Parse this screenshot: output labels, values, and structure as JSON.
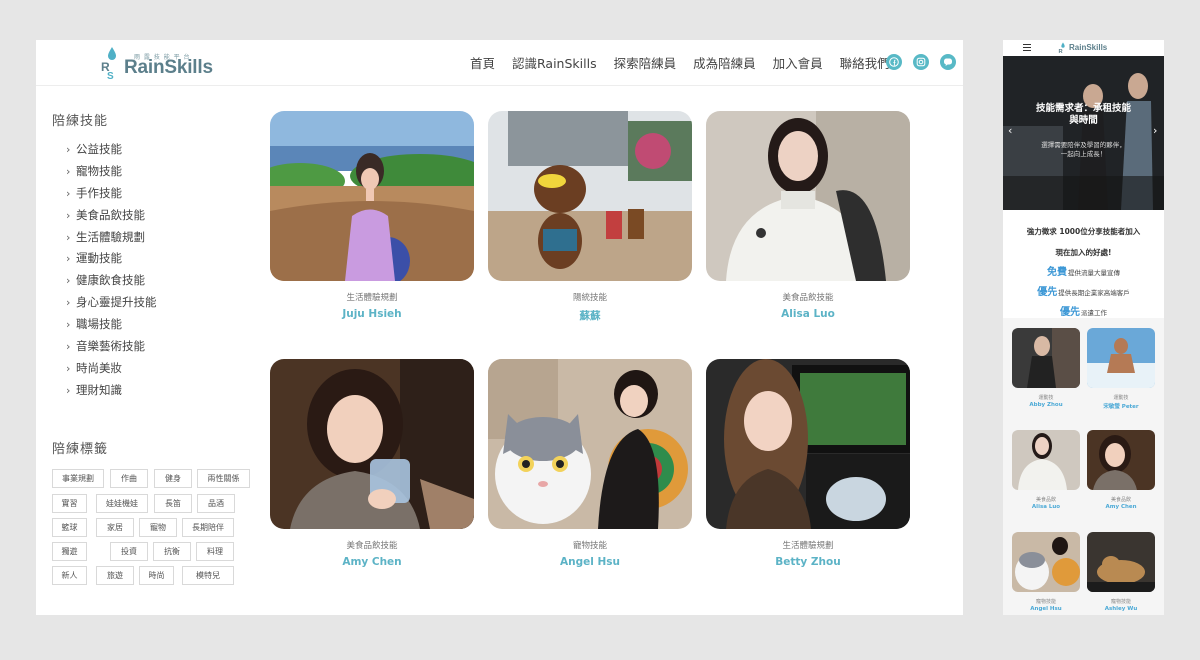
{
  "brand": {
    "name": "RainSkills",
    "subtitle": "雨 露 技 能 平 台"
  },
  "nav": {
    "items": [
      "首頁",
      "認識RainSkills",
      "探索陪練員",
      "成為陪練員",
      "加入會員",
      "聯絡我們"
    ],
    "social_icons": [
      "facebook-icon",
      "instagram-icon",
      "line-icon"
    ]
  },
  "sidebar": {
    "categories_title": "陪練技能",
    "categories": [
      "公益技能",
      "寵物技能",
      "手作技能",
      "美食品飲技能",
      "生活體驗規劃",
      "運動技能",
      "健康飲食技能",
      "身心靈提升技能",
      "職場技能",
      "音樂藝術技能",
      "時尚美妝",
      "理財知識"
    ],
    "tags_title": "陪練標籤",
    "tags": [
      "事業規劃",
      "作曲",
      "健身",
      "兩性關係",
      "實習",
      "娃娃機娃",
      "長笛",
      "品酒",
      "籃球",
      "家居",
      "寵物",
      "長期陪伴",
      "獨遊",
      "投資",
      "抗衡",
      "料理",
      "新人",
      "旅遊",
      "時尚",
      "模特兒"
    ]
  },
  "cards": [
    {
      "category": "生活體驗規劃",
      "name": "Juju Hsieh"
    },
    {
      "category": "陽統技能",
      "name": "蘇蘇"
    },
    {
      "category": "美食品飲技能",
      "name": "Alisa Luo"
    },
    {
      "category": "美食品飲技能",
      "name": "Amy Chen"
    },
    {
      "category": "寵物技能",
      "name": "Angel Hsu"
    },
    {
      "category": "生活體驗規劃",
      "name": "Betty Zhou"
    }
  ],
  "mobile": {
    "hero_title_1": "技能需求者：承租技能",
    "hero_title_2": "與時間",
    "hero_sub_1": "選擇需要陪伴及學習的夥伴，",
    "hero_sub_2": "一起向上成長！",
    "promo_heading": "強力徵求 1000位分享技能者加入",
    "promo_subheading": "現在加入的好處!",
    "promo_lines": [
      {
        "em": "免費",
        "text": "提供流量大量宣傳"
      },
      {
        "em": "優先",
        "text": "提供長期企業家高端客戶"
      },
      {
        "em": "優先",
        "text": "派遣工作"
      }
    ],
    "cards": [
      {
        "category": "運動技",
        "name": "Abby Zhou"
      },
      {
        "category": "運動技",
        "name": "宋敏瑩 Peter"
      },
      {
        "category": "美食品飲",
        "name": "Alisa Luo"
      },
      {
        "category": "美食品飲",
        "name": "Amy Chen"
      },
      {
        "category": "寵物技能",
        "name": "Angel Hsu"
      },
      {
        "category": "寵物技能",
        "name": "Ashley Wu"
      }
    ]
  },
  "colors": {
    "accent": "#5cb3c6",
    "brand": "#5c7f8b",
    "social": "#58b9c6",
    "promo_em": "#3d98d6"
  }
}
